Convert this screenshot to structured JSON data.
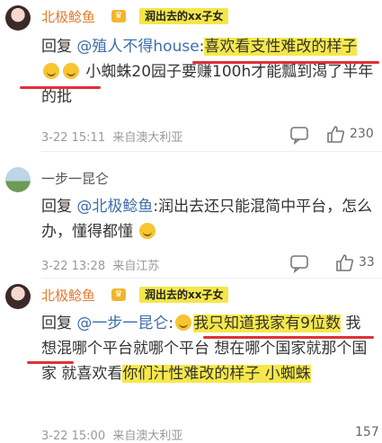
{
  "comments": [
    {
      "name": "北极鲶鱼",
      "tag": "润出去的xx子女",
      "reply_prefix": "回复",
      "mention": "@殖人不得house",
      "text_a": ":",
      "text_hl": "喜欢看支性难改的样子",
      "text_b": "小蜘蛛20园子要赚100h才能瓢到渴了半年的批",
      "date": "3-22 15:11",
      "source": "来自澳大利亚",
      "likes": "230"
    },
    {
      "name": "一步一昆仑",
      "tag": "",
      "reply_prefix": "回复",
      "mention": "@北极鲶鱼",
      "text_a": ":润出去还只能混简中平台，怎么办，懂得都懂",
      "date": "3-22 13:28",
      "source": "来自江苏",
      "likes": "33"
    },
    {
      "name": "北极鲶鱼",
      "tag": "润出去的xx子女",
      "reply_prefix": "回复",
      "mention": "@一步一昆仑",
      "text_a": ":",
      "text_hl1": "我只知道我家有9位数",
      "text_b": "我想混哪个平台就哪个平台 想在哪个国家就那个国家 就喜欢看",
      "text_hl2": "你们汁性难改的样子 小蜘蛛",
      "date": "3-22 15:00",
      "source": "来自澳大利亚",
      "likes": "157"
    }
  ],
  "icons": [
    "comment-icon",
    "like-icon"
  ],
  "colors": {
    "highlight": "#f6e84a",
    "underline": "#e0303a",
    "mention": "#3d6ea8",
    "name": "#e07a2e"
  }
}
